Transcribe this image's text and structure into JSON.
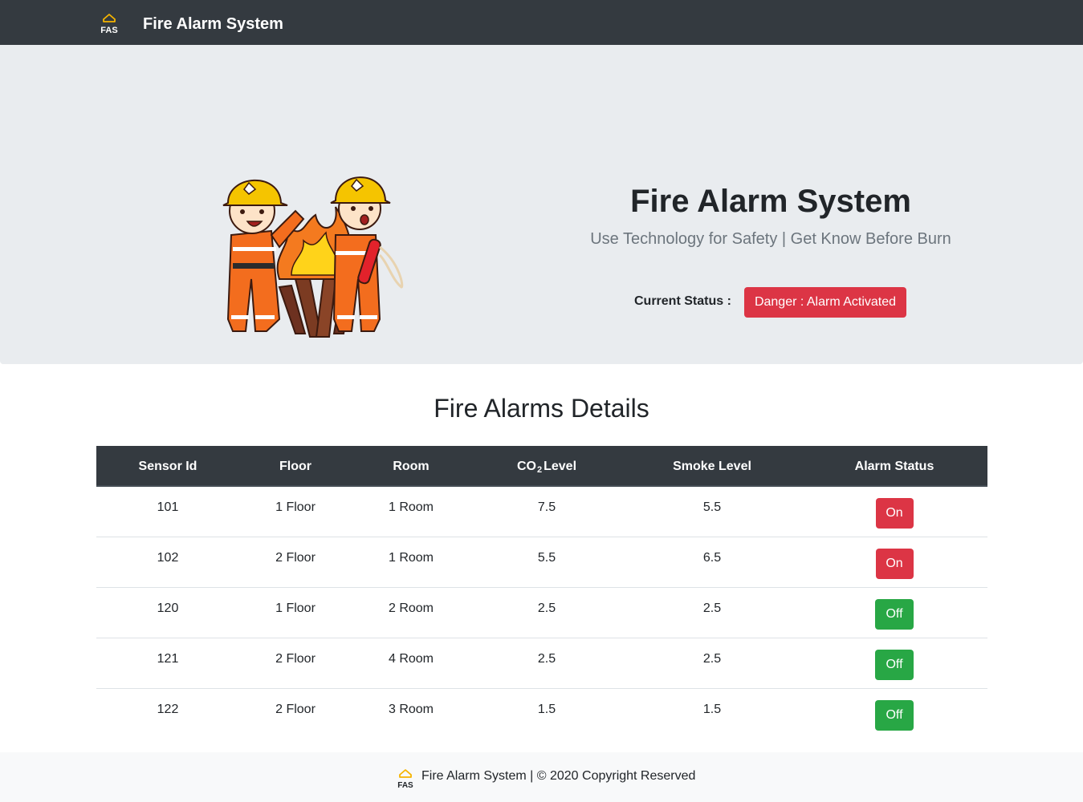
{
  "navbar": {
    "logo_text": "FAS",
    "brand": "Fire Alarm System"
  },
  "hero": {
    "title": "Fire Alarm System",
    "subtitle": "Use Technology for Safety | Get Know Before Burn",
    "status_label": "Current Status :",
    "status_value": "Danger : Alarm Activated",
    "status_color": "#dc3545"
  },
  "details": {
    "title": "Fire Alarms Details",
    "headers": {
      "sensor_id": "Sensor Id",
      "floor": "Floor",
      "room": "Room",
      "co2_prefix": "CO",
      "co2_sub": "2",
      "co2_suffix": "Level",
      "smoke": "Smoke Level",
      "alarm_status": "Alarm Status"
    },
    "rows": [
      {
        "sensor_id": "101",
        "floor": "1 Floor",
        "room": "1 Room",
        "co2": "7.5",
        "smoke": "5.5",
        "status": "On"
      },
      {
        "sensor_id": "102",
        "floor": "2 Floor",
        "room": "1 Room",
        "co2": "5.5",
        "smoke": "6.5",
        "status": "On"
      },
      {
        "sensor_id": "120",
        "floor": "1 Floor",
        "room": "2 Room",
        "co2": "2.5",
        "smoke": "2.5",
        "status": "Off"
      },
      {
        "sensor_id": "121",
        "floor": "2 Floor",
        "room": "4 Room",
        "co2": "2.5",
        "smoke": "2.5",
        "status": "Off"
      },
      {
        "sensor_id": "122",
        "floor": "2 Floor",
        "room": "3 Room",
        "co2": "1.5",
        "smoke": "1.5",
        "status": "Off"
      }
    ]
  },
  "footer": {
    "logo_text": "FAS",
    "text": "Fire Alarm System | © 2020 Copyright Reserved"
  },
  "colors": {
    "navbar_bg": "#343a40",
    "hero_bg": "#e9ecef",
    "danger": "#dc3545",
    "success": "#28a745",
    "logo_accent": "#f5b400"
  },
  "icons": {
    "brand": "fas-house-logo-icon",
    "hero": "firefighters-illustration"
  }
}
